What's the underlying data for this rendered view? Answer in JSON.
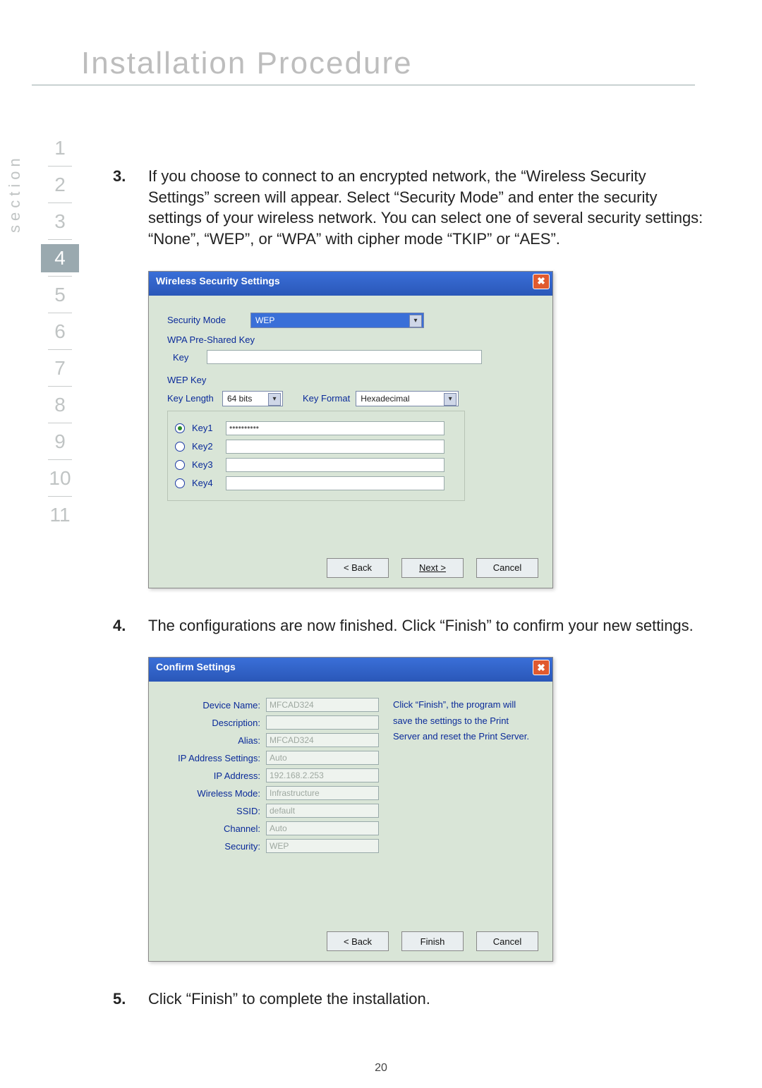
{
  "page": {
    "title": "Installation Procedure",
    "section_label": "section",
    "number": "20"
  },
  "sections": [
    "1",
    "2",
    "3",
    "4",
    "5",
    "6",
    "7",
    "8",
    "9",
    "10",
    "11"
  ],
  "active_section_index": 3,
  "step3": {
    "num": "3.",
    "text": "If you choose to connect to an encrypted network, the “Wireless Security Settings” screen will appear. Select “Security Mode” and enter the security settings of your wireless network. You can select one of several security settings: “None”, “WEP”, or “WPA” with cipher mode “TKIP” or “AES”."
  },
  "step4": {
    "num": "4.",
    "text": "The configurations are now finished. Click “Finish” to confirm your new settings."
  },
  "step5": {
    "num": "5.",
    "text": "Click “Finish” to complete the installation."
  },
  "dlg1": {
    "title": "Wireless Security Settings",
    "security_mode_label": "Security Mode",
    "security_mode_value": "WEP",
    "wpa_section": "WPA Pre-Shared Key",
    "key_label": "Key",
    "key_value": "",
    "wep_section": "WEP Key",
    "key_length_label": "Key Length",
    "key_length_value": "64 bits",
    "key_format_label": "Key Format",
    "key_format_value": "Hexadecimal",
    "keys": [
      {
        "label": "Key1",
        "value": "••••••••••",
        "checked": true
      },
      {
        "label": "Key2",
        "value": "",
        "checked": false
      },
      {
        "label": "Key3",
        "value": "",
        "checked": false
      },
      {
        "label": "Key4",
        "value": "",
        "checked": false
      }
    ],
    "buttons": {
      "back": "< Back",
      "next": "Next >",
      "cancel": "Cancel"
    }
  },
  "dlg2": {
    "title": "Confirm Settings",
    "right_text": "Click “Finish”, the program will save the settings to the Print Server and reset the Print Server.",
    "rows": [
      {
        "label": "Device Name:",
        "value": "MFCAD324"
      },
      {
        "label": "Description:",
        "value": ""
      },
      {
        "label": "Alias:",
        "value": "MFCAD324"
      },
      {
        "label": "IP Address Settings:",
        "value": "Auto"
      },
      {
        "label": "IP Address:",
        "value": "192.168.2.253"
      },
      {
        "label": "Wireless Mode:",
        "value": "Infrastructure"
      },
      {
        "label": "SSID:",
        "value": "default"
      },
      {
        "label": "Channel:",
        "value": "Auto"
      },
      {
        "label": "Security:",
        "value": "WEP"
      }
    ],
    "buttons": {
      "back": "< Back",
      "finish": "Finish",
      "cancel": "Cancel"
    }
  }
}
